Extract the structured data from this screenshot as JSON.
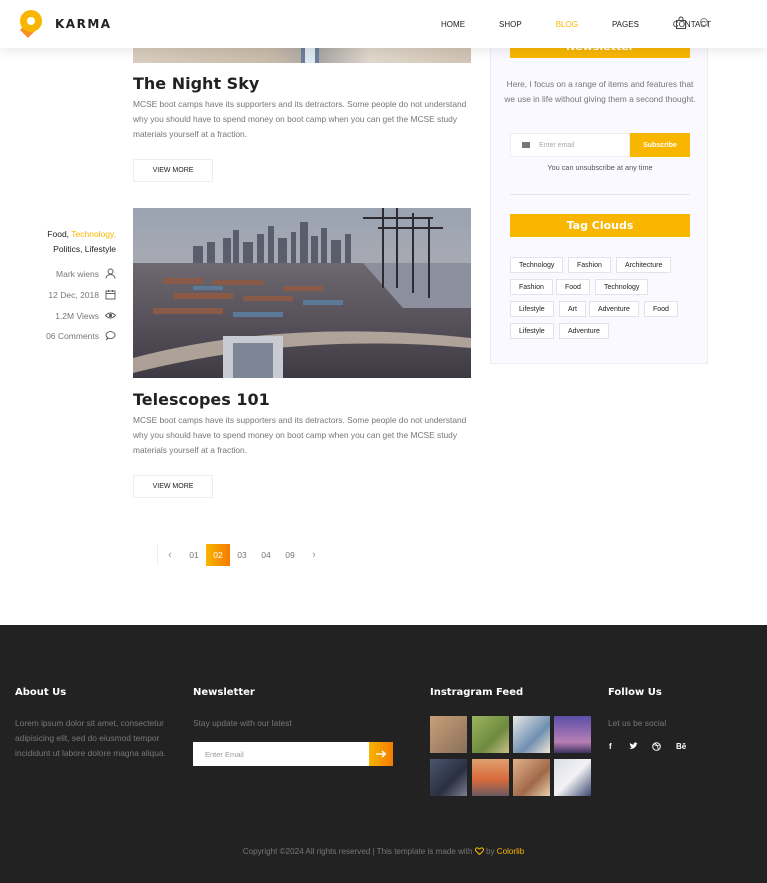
{
  "header": {
    "brand": "KARMA",
    "nav": [
      "HOME",
      "SHOP",
      "BLOG",
      "PAGES",
      "CONTACT"
    ],
    "active_nav": "BLOG",
    "cart_icon": "shopping-bag-icon",
    "search_icon": "search-icon"
  },
  "posts": [
    {
      "title": "The Night Sky",
      "excerpt": "MCSE boot camps have its supporters and its detractors. Some people do not understand why you should have to spend money on boot camp when you can get the MCSE study materials yourself at a fraction.",
      "button": "VIEW MORE"
    },
    {
      "title": "Telescopes 101",
      "excerpt": "MCSE boot camps have its supporters and its detractors. Some people do not understand why you should have to spend money on boot camp when you can get the MCSE study materials yourself at a fraction.",
      "button": "VIEW MORE",
      "meta": {
        "tag_food": "Food,",
        "tag_tech": "Technology,",
        "tag_rest": "Politics, Lifestyle",
        "author": "Mark wiens",
        "date": "12 Dec, 2018",
        "views": "1.2M Views",
        "comments": "06 Comments"
      }
    }
  ],
  "pagination": {
    "pages": [
      "01",
      "02",
      "03",
      "04",
      "09"
    ],
    "active": "02",
    "prev": "‹",
    "next": "›"
  },
  "sidebar": {
    "newsletter_heading": "Newsletter",
    "newsletter_text": "Here, I focus on a range of items and features that we use in life without giving them a second thought.",
    "email_placeholder": "Enter email",
    "subscribe": "Subscribe",
    "unsubscribe_note": "You can unsubscribe at any time",
    "tags_heading": "Tag Clouds",
    "tags": [
      "Technology",
      "Fashion",
      "Architecture",
      "Fashion",
      "Food",
      "Technology",
      "Lifestyle",
      "Art",
      "Adventure",
      "Food",
      "Lifestyle",
      "Adventure"
    ]
  },
  "footer": {
    "about_title": "About Us",
    "about_text": "Lorem ipsum dolor sit amet, consectetur adipisicing elit, sed do eiusmod tempor incididunt ut labore dolore magna aliqua.",
    "newsletter_title": "Newsletter",
    "newsletter_text": "Stay update with our latest",
    "newsletter_placeholder": "Enter Email",
    "instagram_title": "Instragram Feed",
    "follow_title": "Follow Us",
    "follow_text": "Let us be social",
    "social": [
      "f",
      "t",
      "dribbble",
      "Bē"
    ],
    "copyright_text": "Copyright ©2024 All rights reserved | This template is made with",
    "copyright_by": "by",
    "copyright_brand": "Colorlib"
  },
  "colors": {
    "accent": "#f8b600",
    "accent_dark": "#f57b00",
    "footer_bg": "#222222"
  }
}
